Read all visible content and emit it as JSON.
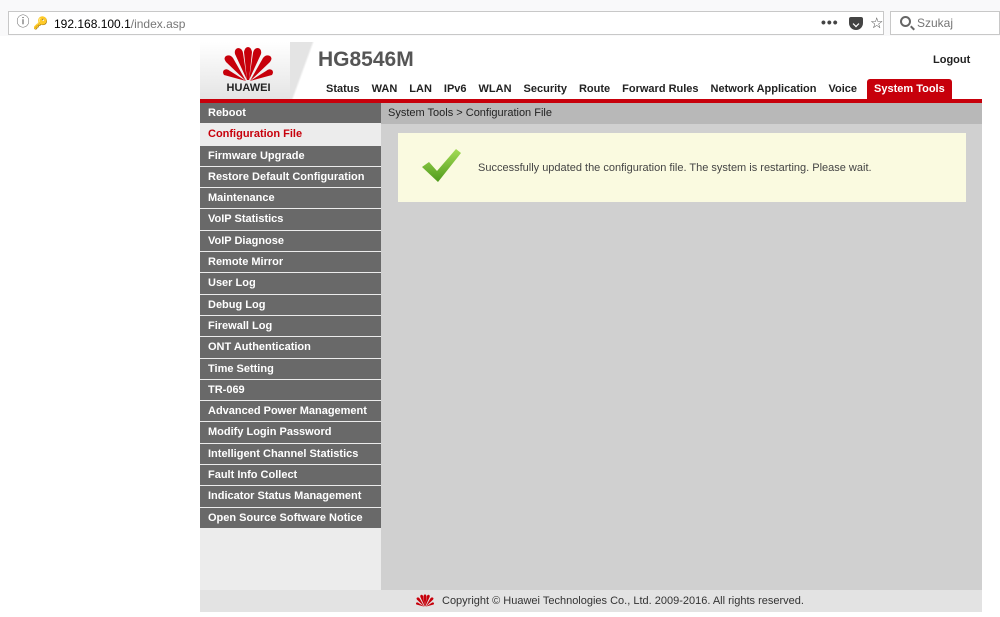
{
  "browser": {
    "url_host": "192.168.100.1",
    "url_path": "/index.asp",
    "search_placeholder": "Szukaj",
    "more_label": "•••"
  },
  "header": {
    "brand": "HUAWEI",
    "model": "HG8546M",
    "logout": "Logout"
  },
  "nav": {
    "items": [
      "Status",
      "WAN",
      "LAN",
      "IPv6",
      "WLAN",
      "Security",
      "Route",
      "Forward Rules",
      "Network Application",
      "Voice",
      "System Tools"
    ],
    "active": "System Tools"
  },
  "sidebar": {
    "items": [
      "Reboot",
      "Configuration File",
      "Firmware Upgrade",
      "Restore Default Configuration",
      "Maintenance",
      "VoIP Statistics",
      "VoIP Diagnose",
      "Remote Mirror",
      "User Log",
      "Debug Log",
      "Firewall Log",
      "ONT Authentication",
      "Time Setting",
      "TR-069",
      "Advanced Power Management",
      "Modify Login Password",
      "Intelligent Channel Statistics",
      "Fault Info Collect",
      "Indicator Status Management",
      "Open Source Software Notice"
    ],
    "active": "Configuration File"
  },
  "content": {
    "breadcrumb": "System Tools > Configuration File",
    "message": "Successfully updated the configuration file. The system is restarting. Please wait."
  },
  "footer": {
    "copyright": "Copyright © Huawei Technologies Co., Ltd. 2009-2016. All rights reserved."
  },
  "colors": {
    "brand_red": "#c7000b",
    "sidebar_gray": "#696969",
    "content_gray": "#d0d0d0",
    "message_bg": "#fafae0",
    "check_green": "#6dbb2c"
  }
}
